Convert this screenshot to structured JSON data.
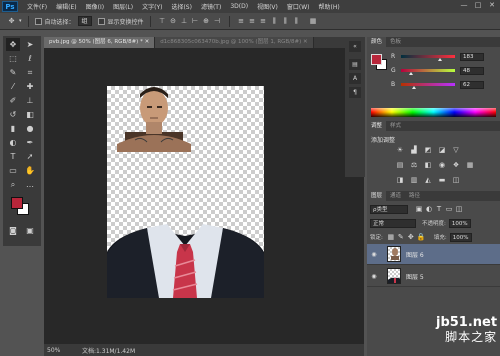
{
  "app": {
    "logo": "Ps"
  },
  "menu": [
    "文件(F)",
    "编辑(E)",
    "图像(I)",
    "图层(L)",
    "文字(Y)",
    "选择(S)",
    "滤镜(T)",
    "3D(D)",
    "视图(V)",
    "窗口(W)",
    "帮助(H)"
  ],
  "window_controls": [
    "—",
    "□",
    "✕"
  ],
  "options_bar": {
    "auto_select_label": "自动选择：",
    "auto_select_value": "组",
    "show_transform_label": "显示变换控件"
  },
  "tabs": [
    {
      "label": "pvb.jpg @ 50% (图层 6, RGB/8#) * ✕"
    },
    {
      "label": "d1c868305c063470b.jpg @ 100% (图层 1, RGB/8#) ✕"
    }
  ],
  "status": {
    "zoom": "50%",
    "doc_size": "文档:1.31M/1.42M"
  },
  "color_panel": {
    "tabs": [
      "颜色",
      "色板"
    ],
    "fg_color": "#b8263a",
    "bg_color": "#ffffff",
    "channels": [
      {
        "label": "R",
        "value": "183"
      },
      {
        "label": "G",
        "value": "48"
      },
      {
        "label": "B",
        "value": "62"
      }
    ]
  },
  "adjustments_panel": {
    "tabs": [
      "调整",
      "样式"
    ],
    "title": "添加调整"
  },
  "layers_panel": {
    "tabs": [
      "图层",
      "通道",
      "路径"
    ],
    "filter_label": "ρ类型",
    "blend_mode": "正常",
    "opacity_label": "不透明度:",
    "opacity_value": "100%",
    "lock_label": "锁定:",
    "fill_label": "填充:",
    "fill_value": "100%",
    "layers": [
      {
        "name": "图层 6",
        "selected": true
      },
      {
        "name": "图层 5",
        "selected": false
      }
    ]
  },
  "watermark": {
    "domain": "jb51.net",
    "subtitle": "脚本之家"
  }
}
